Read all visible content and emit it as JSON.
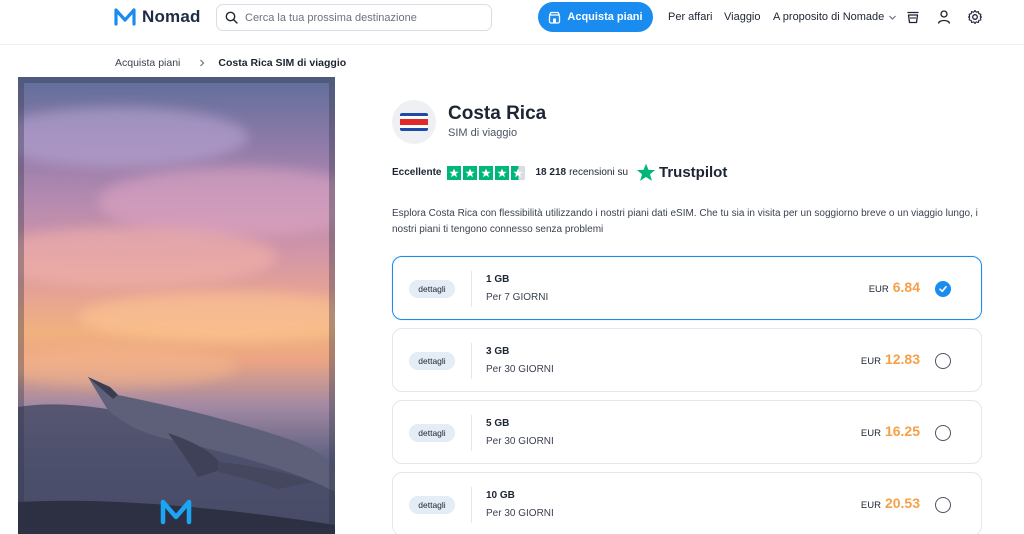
{
  "header": {
    "logo_text": "Nomad",
    "search_placeholder": "Cerca la tua prossima destinazione",
    "buy_button": "Acquista piani",
    "nav": [
      "Per affari",
      "Viaggio",
      "A proposito di Nomade"
    ]
  },
  "breadcrumb": {
    "parent": "Acquista piani",
    "current": "Costa Rica SIM di viaggio"
  },
  "product": {
    "country": "Costa Rica",
    "subtitle": "SIM di viaggio",
    "rating_label": "Eccellente",
    "reviews_count": "18 218",
    "reviews_suffix": "recensioni su",
    "trustpilot": "Trustpilot",
    "description": "Esplora Costa Rica con flessibilità utilizzando i nostri piani dati eSIM. Che tu sia in visita per un soggiorno breve o un viaggio lungo, i nostri piani ti tengono connesso senza problemi"
  },
  "plans": [
    {
      "details": "dettagli",
      "data": "1 GB",
      "days": "Per 7 GIORNI",
      "currency": "EUR",
      "price": "6.84",
      "selected": true
    },
    {
      "details": "dettagli",
      "data": "3 GB",
      "days": "Per 30 GIORNI",
      "currency": "EUR",
      "price": "12.83",
      "selected": false
    },
    {
      "details": "dettagli",
      "data": "5 GB",
      "days": "Per 30 GIORNI",
      "currency": "EUR",
      "price": "16.25",
      "selected": false
    },
    {
      "details": "dettagli",
      "data": "10 GB",
      "days": "Per 30 GIORNI",
      "currency": "EUR",
      "price": "20.53",
      "selected": false
    }
  ],
  "colors": {
    "accent": "#1a8cf0",
    "price": "#f5a047",
    "trustpilot_green": "#00b67a"
  },
  "icons": [
    "nomad-logo-icon",
    "search-icon",
    "store-icon",
    "chevron-down-icon",
    "cup-icon",
    "user-icon",
    "gear-icon",
    "check-icon",
    "star-icon",
    "costa-rica-flag-icon"
  ]
}
